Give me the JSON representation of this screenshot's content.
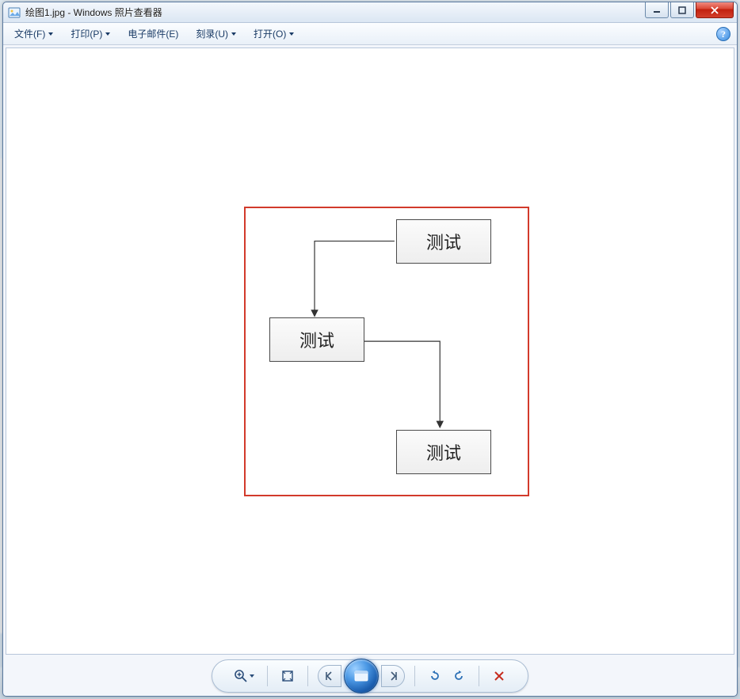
{
  "titlebar": {
    "icon": "image-icon",
    "title": "绘图1.jpg - Windows 照片查看器"
  },
  "menubar": {
    "items": [
      {
        "label": "文件(F)",
        "has_dropdown": true
      },
      {
        "label": "打印(P)",
        "has_dropdown": true
      },
      {
        "label": "电子邮件(E)",
        "has_dropdown": false
      },
      {
        "label": "刻录(U)",
        "has_dropdown": true
      },
      {
        "label": "打开(O)",
        "has_dropdown": true
      }
    ],
    "help": "?"
  },
  "diagram": {
    "nodes": {
      "n1": "测试",
      "n2": "测试",
      "n3": "测试"
    }
  },
  "toolbar": {
    "zoom": "zoom",
    "fit": "fit-screen",
    "prev": "previous",
    "slideshow": "slideshow",
    "next": "next",
    "rotate_ccw": "rotate-ccw",
    "rotate_cw": "rotate-cw",
    "delete": "delete"
  }
}
